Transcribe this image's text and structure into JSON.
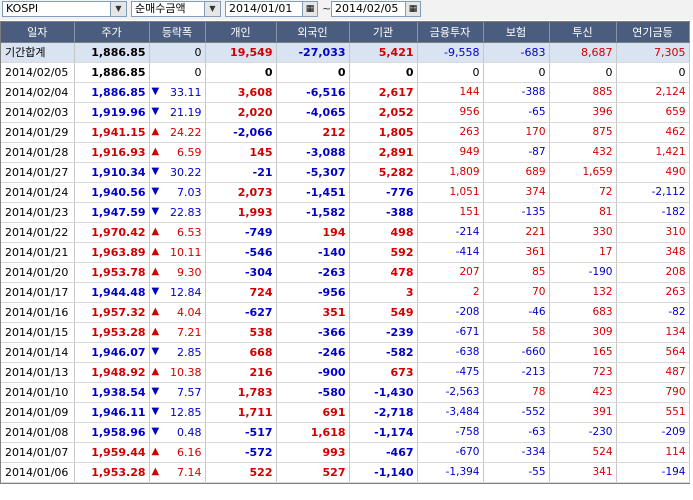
{
  "toolbar": {
    "market": "KOSPI",
    "metric": "순매수금액",
    "date_from": "2014/01/01",
    "date_to": "2014/02/05",
    "separator": "~"
  },
  "columns": [
    "일자",
    "주가",
    "등락폭",
    "개인",
    "외국인",
    "기관",
    "금융투자",
    "보험",
    "투신",
    "연기금등"
  ],
  "total": {
    "date": "기간합계",
    "price": "1,886.85",
    "change": "0",
    "individual": "19,549",
    "foreign": "-27,033",
    "institution": "5,421",
    "fin_invest": "-9,558",
    "insurance": "-683",
    "trust": "8,687",
    "pension": "7,305"
  },
  "rows": [
    {
      "date": "2014/02/05",
      "price": "1,886.85",
      "dir": "",
      "change": "0",
      "individual": "0",
      "foreign": "0",
      "institution": "0",
      "fin_invest": "0",
      "insurance": "0",
      "trust": "0",
      "pension": "0"
    },
    {
      "date": "2014/02/04",
      "price": "1,886.85",
      "dir": "down",
      "change": "33.11",
      "individual": "3,608",
      "foreign": "-6,516",
      "institution": "2,617",
      "fin_invest": "144",
      "insurance": "-388",
      "trust": "885",
      "pension": "2,124"
    },
    {
      "date": "2014/02/03",
      "price": "1,919.96",
      "dir": "down",
      "change": "21.19",
      "individual": "2,020",
      "foreign": "-4,065",
      "institution": "2,052",
      "fin_invest": "956",
      "insurance": "-65",
      "trust": "396",
      "pension": "659"
    },
    {
      "date": "2014/01/29",
      "price": "1,941.15",
      "dir": "up",
      "change": "24.22",
      "individual": "-2,066",
      "foreign": "212",
      "institution": "1,805",
      "fin_invest": "263",
      "insurance": "170",
      "trust": "875",
      "pension": "462"
    },
    {
      "date": "2014/01/28",
      "price": "1,916.93",
      "dir": "up",
      "change": "6.59",
      "individual": "145",
      "foreign": "-3,088",
      "institution": "2,891",
      "fin_invest": "949",
      "insurance": "-87",
      "trust": "432",
      "pension": "1,421"
    },
    {
      "date": "2014/01/27",
      "price": "1,910.34",
      "dir": "down",
      "change": "30.22",
      "individual": "-21",
      "foreign": "-5,307",
      "institution": "5,282",
      "fin_invest": "1,809",
      "insurance": "689",
      "trust": "1,659",
      "pension": "490"
    },
    {
      "date": "2014/01/24",
      "price": "1,940.56",
      "dir": "down",
      "change": "7.03",
      "individual": "2,073",
      "foreign": "-1,451",
      "institution": "-776",
      "fin_invest": "1,051",
      "insurance": "374",
      "trust": "72",
      "pension": "-2,112"
    },
    {
      "date": "2014/01/23",
      "price": "1,947.59",
      "dir": "down",
      "change": "22.83",
      "individual": "1,993",
      "foreign": "-1,582",
      "institution": "-388",
      "fin_invest": "151",
      "insurance": "-135",
      "trust": "81",
      "pension": "-182"
    },
    {
      "date": "2014/01/22",
      "price": "1,970.42",
      "dir": "up",
      "change": "6.53",
      "individual": "-749",
      "foreign": "194",
      "institution": "498",
      "fin_invest": "-214",
      "insurance": "221",
      "trust": "330",
      "pension": "310"
    },
    {
      "date": "2014/01/21",
      "price": "1,963.89",
      "dir": "up",
      "change": "10.11",
      "individual": "-546",
      "foreign": "-140",
      "institution": "592",
      "fin_invest": "-414",
      "insurance": "361",
      "trust": "17",
      "pension": "348"
    },
    {
      "date": "2014/01/20",
      "price": "1,953.78",
      "dir": "up",
      "change": "9.30",
      "individual": "-304",
      "foreign": "-263",
      "institution": "478",
      "fin_invest": "207",
      "insurance": "85",
      "trust": "-190",
      "pension": "208"
    },
    {
      "date": "2014/01/17",
      "price": "1,944.48",
      "dir": "down",
      "change": "12.84",
      "individual": "724",
      "foreign": "-956",
      "institution": "3",
      "fin_invest": "2",
      "insurance": "70",
      "trust": "132",
      "pension": "263"
    },
    {
      "date": "2014/01/16",
      "price": "1,957.32",
      "dir": "up",
      "change": "4.04",
      "individual": "-627",
      "foreign": "351",
      "institution": "549",
      "fin_invest": "-208",
      "insurance": "-46",
      "trust": "683",
      "pension": "-82"
    },
    {
      "date": "2014/01/15",
      "price": "1,953.28",
      "dir": "up",
      "change": "7.21",
      "individual": "538",
      "foreign": "-366",
      "institution": "-239",
      "fin_invest": "-671",
      "insurance": "58",
      "trust": "309",
      "pension": "134"
    },
    {
      "date": "2014/01/14",
      "price": "1,946.07",
      "dir": "down",
      "change": "2.85",
      "individual": "668",
      "foreign": "-246",
      "institution": "-582",
      "fin_invest": "-638",
      "insurance": "-660",
      "trust": "165",
      "pension": "564"
    },
    {
      "date": "2014/01/13",
      "price": "1,948.92",
      "dir": "up",
      "change": "10.38",
      "individual": "216",
      "foreign": "-900",
      "institution": "673",
      "fin_invest": "-475",
      "insurance": "-213",
      "trust": "723",
      "pension": "487"
    },
    {
      "date": "2014/01/10",
      "price": "1,938.54",
      "dir": "down",
      "change": "7.57",
      "individual": "1,783",
      "foreign": "-580",
      "institution": "-1,430",
      "fin_invest": "-2,563",
      "insurance": "78",
      "trust": "423",
      "pension": "790"
    },
    {
      "date": "2014/01/09",
      "price": "1,946.11",
      "dir": "down",
      "change": "12.85",
      "individual": "1,711",
      "foreign": "691",
      "institution": "-2,718",
      "fin_invest": "-3,484",
      "insurance": "-552",
      "trust": "391",
      "pension": "551"
    },
    {
      "date": "2014/01/08",
      "price": "1,958.96",
      "dir": "down",
      "change": "0.48",
      "individual": "-517",
      "foreign": "1,618",
      "institution": "-1,174",
      "fin_invest": "-758",
      "insurance": "-63",
      "trust": "-230",
      "pension": "-209"
    },
    {
      "date": "2014/01/07",
      "price": "1,959.44",
      "dir": "up",
      "change": "6.16",
      "individual": "-572",
      "foreign": "993",
      "institution": "-467",
      "fin_invest": "-670",
      "insurance": "-334",
      "trust": "524",
      "pension": "114"
    },
    {
      "date": "2014/01/06",
      "price": "1,953.28",
      "dir": "up",
      "change": "7.14",
      "individual": "522",
      "foreign": "527",
      "institution": "-1,140",
      "fin_invest": "-1,394",
      "insurance": "-55",
      "trust": "341",
      "pension": "-194"
    }
  ]
}
